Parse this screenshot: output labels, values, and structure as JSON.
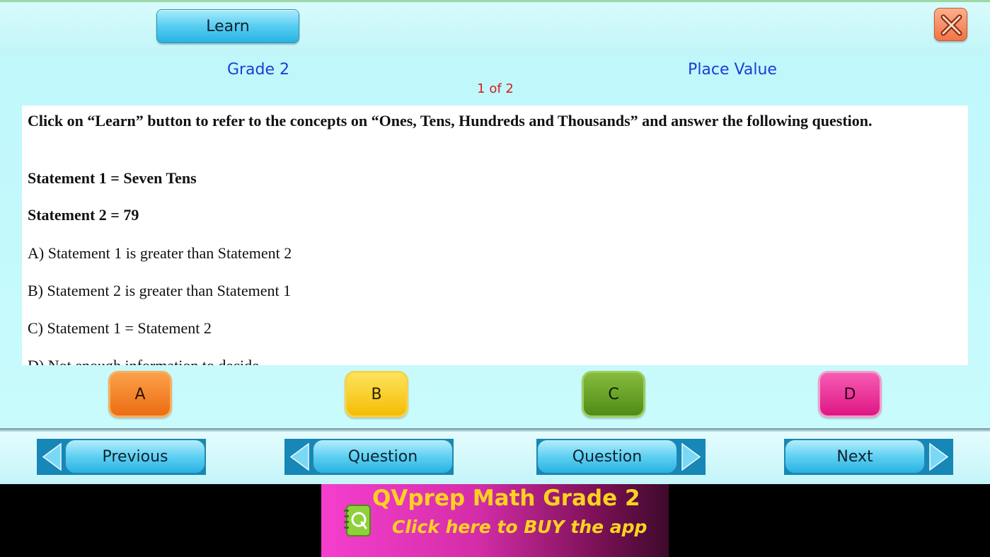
{
  "header": {
    "learn_label": "Learn",
    "close_icon": "close-x-icon"
  },
  "info": {
    "grade": "Grade 2",
    "topic": "Place Value",
    "counter": "1 of 2"
  },
  "question": {
    "intro": "Click on “Learn” button to refer to the concepts on “Ones, Tens, Hundreds and Thousands” and answer the following question.",
    "statement1": "Statement 1 = Seven Tens",
    "statement2": "Statement 2 = 79",
    "options": [
      "A)   Statement  1 is greater than Statement 2",
      "B)   Statement  2 is greater than Statement 1",
      "C)   Statement 1 = Statement 2",
      "D)   Not enough information to decide"
    ]
  },
  "answers": {
    "a": "A",
    "b": "B",
    "c": "C",
    "d": "D"
  },
  "nav": {
    "previous": "Previous",
    "question_prev": "Question",
    "question_next": "Question",
    "next": "Next"
  },
  "banner": {
    "title": "QVprep Math Grade 2",
    "subtitle": "Click here to BUY the app",
    "logo_icon": "qvprep-notebook-logo-icon"
  },
  "colors": {
    "background": "#c4f8fb",
    "label_blue": "#1a3ed6",
    "counter_red": "#d11e1e",
    "btn_a": "#ec6d12",
    "btn_b": "#f4bd05",
    "btn_c": "#4f8c17",
    "btn_d": "#df1685",
    "banner_text": "#ffd21f"
  }
}
